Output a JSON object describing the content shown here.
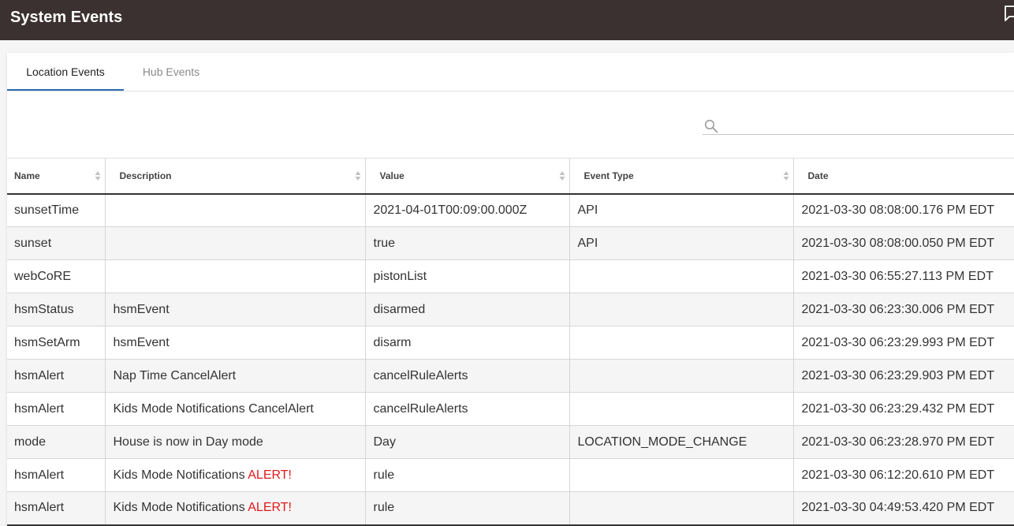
{
  "header": {
    "title": "System Events"
  },
  "tabs": [
    {
      "label": "Location Events",
      "active": true
    },
    {
      "label": "Hub Events",
      "active": false
    }
  ],
  "search": {
    "value": "",
    "placeholder": ""
  },
  "table": {
    "columns": [
      "Name",
      "Description",
      "Value",
      "Event Type",
      "Date"
    ],
    "rows": [
      {
        "name": "sunsetTime",
        "description": "",
        "description_alert": "",
        "value": "2021-04-01T00:09:00.000Z",
        "event_type": "API",
        "date": "2021-03-30 08:08:00.176 PM EDT"
      },
      {
        "name": "sunset",
        "description": "",
        "description_alert": "",
        "value": "true",
        "event_type": "API",
        "date": "2021-03-30 08:08:00.050 PM EDT"
      },
      {
        "name": "webCoRE",
        "description": "",
        "description_alert": "",
        "value": "pistonList",
        "event_type": "",
        "date": "2021-03-30 06:55:27.113 PM EDT"
      },
      {
        "name": "hsmStatus",
        "description": "hsmEvent",
        "description_alert": "",
        "value": "disarmed",
        "event_type": "",
        "date": "2021-03-30 06:23:30.006 PM EDT"
      },
      {
        "name": "hsmSetArm",
        "description": "hsmEvent",
        "description_alert": "",
        "value": "disarm",
        "event_type": "",
        "date": "2021-03-30 06:23:29.993 PM EDT"
      },
      {
        "name": "hsmAlert",
        "description": "Nap Time CancelAlert",
        "description_alert": "",
        "value": "cancelRuleAlerts",
        "event_type": "",
        "date": "2021-03-30 06:23:29.903 PM EDT"
      },
      {
        "name": "hsmAlert",
        "description": "Kids Mode Notifications CancelAlert",
        "description_alert": "",
        "value": "cancelRuleAlerts",
        "event_type": "",
        "date": "2021-03-30 06:23:29.432 PM EDT"
      },
      {
        "name": "mode",
        "description": "House is now in Day mode",
        "description_alert": "",
        "value": "Day",
        "event_type": "LOCATION_MODE_CHANGE",
        "date": "2021-03-30 06:23:28.970 PM EDT"
      },
      {
        "name": "hsmAlert",
        "description": "Kids Mode Notifications ",
        "description_alert": "ALERT!",
        "value": "rule",
        "event_type": "",
        "date": "2021-03-30 06:12:20.610 PM EDT"
      },
      {
        "name": "hsmAlert",
        "description": "Kids Mode Notifications ",
        "description_alert": "ALERT!",
        "value": "rule",
        "event_type": "",
        "date": "2021-03-30 04:49:53.420 PM EDT"
      }
    ]
  },
  "icons": {
    "search": "search-icon",
    "sort": "sort-icon",
    "chat": "chat-icon"
  },
  "colors": {
    "topbar": "#3b3130",
    "active_tab_underline": "#2b6cb0",
    "alert_text": "#e3191c"
  }
}
